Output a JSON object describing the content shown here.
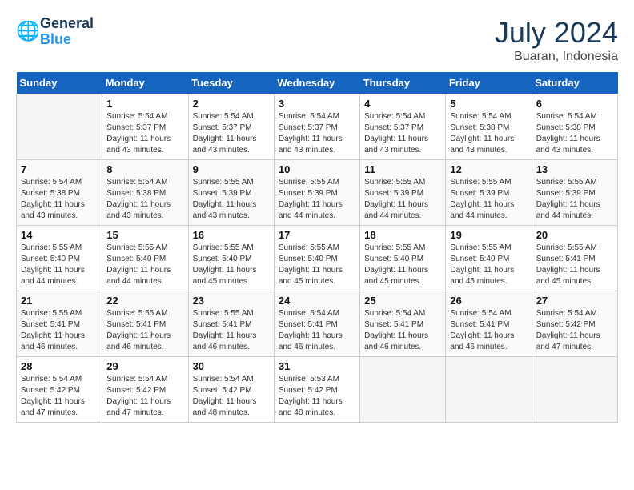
{
  "header": {
    "logo_line1": "General",
    "logo_line2": "Blue",
    "month": "July 2024",
    "location": "Buaran, Indonesia"
  },
  "weekdays": [
    "Sunday",
    "Monday",
    "Tuesday",
    "Wednesday",
    "Thursday",
    "Friday",
    "Saturday"
  ],
  "weeks": [
    [
      {
        "day": "",
        "info": ""
      },
      {
        "day": "1",
        "info": "Sunrise: 5:54 AM\nSunset: 5:37 PM\nDaylight: 11 hours\nand 43 minutes."
      },
      {
        "day": "2",
        "info": "Sunrise: 5:54 AM\nSunset: 5:37 PM\nDaylight: 11 hours\nand 43 minutes."
      },
      {
        "day": "3",
        "info": "Sunrise: 5:54 AM\nSunset: 5:37 PM\nDaylight: 11 hours\nand 43 minutes."
      },
      {
        "day": "4",
        "info": "Sunrise: 5:54 AM\nSunset: 5:37 PM\nDaylight: 11 hours\nand 43 minutes."
      },
      {
        "day": "5",
        "info": "Sunrise: 5:54 AM\nSunset: 5:38 PM\nDaylight: 11 hours\nand 43 minutes."
      },
      {
        "day": "6",
        "info": "Sunrise: 5:54 AM\nSunset: 5:38 PM\nDaylight: 11 hours\nand 43 minutes."
      }
    ],
    [
      {
        "day": "7",
        "info": "Sunrise: 5:54 AM\nSunset: 5:38 PM\nDaylight: 11 hours\nand 43 minutes."
      },
      {
        "day": "8",
        "info": "Sunrise: 5:54 AM\nSunset: 5:38 PM\nDaylight: 11 hours\nand 43 minutes."
      },
      {
        "day": "9",
        "info": "Sunrise: 5:55 AM\nSunset: 5:39 PM\nDaylight: 11 hours\nand 43 minutes."
      },
      {
        "day": "10",
        "info": "Sunrise: 5:55 AM\nSunset: 5:39 PM\nDaylight: 11 hours\nand 44 minutes."
      },
      {
        "day": "11",
        "info": "Sunrise: 5:55 AM\nSunset: 5:39 PM\nDaylight: 11 hours\nand 44 minutes."
      },
      {
        "day": "12",
        "info": "Sunrise: 5:55 AM\nSunset: 5:39 PM\nDaylight: 11 hours\nand 44 minutes."
      },
      {
        "day": "13",
        "info": "Sunrise: 5:55 AM\nSunset: 5:39 PM\nDaylight: 11 hours\nand 44 minutes."
      }
    ],
    [
      {
        "day": "14",
        "info": "Sunrise: 5:55 AM\nSunset: 5:40 PM\nDaylight: 11 hours\nand 44 minutes."
      },
      {
        "day": "15",
        "info": "Sunrise: 5:55 AM\nSunset: 5:40 PM\nDaylight: 11 hours\nand 44 minutes."
      },
      {
        "day": "16",
        "info": "Sunrise: 5:55 AM\nSunset: 5:40 PM\nDaylight: 11 hours\nand 45 minutes."
      },
      {
        "day": "17",
        "info": "Sunrise: 5:55 AM\nSunset: 5:40 PM\nDaylight: 11 hours\nand 45 minutes."
      },
      {
        "day": "18",
        "info": "Sunrise: 5:55 AM\nSunset: 5:40 PM\nDaylight: 11 hours\nand 45 minutes."
      },
      {
        "day": "19",
        "info": "Sunrise: 5:55 AM\nSunset: 5:40 PM\nDaylight: 11 hours\nand 45 minutes."
      },
      {
        "day": "20",
        "info": "Sunrise: 5:55 AM\nSunset: 5:41 PM\nDaylight: 11 hours\nand 45 minutes."
      }
    ],
    [
      {
        "day": "21",
        "info": "Sunrise: 5:55 AM\nSunset: 5:41 PM\nDaylight: 11 hours\nand 46 minutes."
      },
      {
        "day": "22",
        "info": "Sunrise: 5:55 AM\nSunset: 5:41 PM\nDaylight: 11 hours\nand 46 minutes."
      },
      {
        "day": "23",
        "info": "Sunrise: 5:55 AM\nSunset: 5:41 PM\nDaylight: 11 hours\nand 46 minutes."
      },
      {
        "day": "24",
        "info": "Sunrise: 5:54 AM\nSunset: 5:41 PM\nDaylight: 11 hours\nand 46 minutes."
      },
      {
        "day": "25",
        "info": "Sunrise: 5:54 AM\nSunset: 5:41 PM\nDaylight: 11 hours\nand 46 minutes."
      },
      {
        "day": "26",
        "info": "Sunrise: 5:54 AM\nSunset: 5:41 PM\nDaylight: 11 hours\nand 46 minutes."
      },
      {
        "day": "27",
        "info": "Sunrise: 5:54 AM\nSunset: 5:42 PM\nDaylight: 11 hours\nand 47 minutes."
      }
    ],
    [
      {
        "day": "28",
        "info": "Sunrise: 5:54 AM\nSunset: 5:42 PM\nDaylight: 11 hours\nand 47 minutes."
      },
      {
        "day": "29",
        "info": "Sunrise: 5:54 AM\nSunset: 5:42 PM\nDaylight: 11 hours\nand 47 minutes."
      },
      {
        "day": "30",
        "info": "Sunrise: 5:54 AM\nSunset: 5:42 PM\nDaylight: 11 hours\nand 48 minutes."
      },
      {
        "day": "31",
        "info": "Sunrise: 5:53 AM\nSunset: 5:42 PM\nDaylight: 11 hours\nand 48 minutes."
      },
      {
        "day": "",
        "info": ""
      },
      {
        "day": "",
        "info": ""
      },
      {
        "day": "",
        "info": ""
      }
    ]
  ]
}
